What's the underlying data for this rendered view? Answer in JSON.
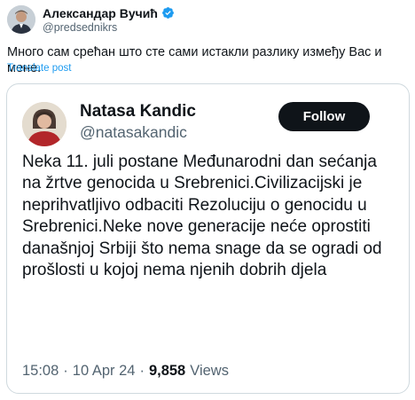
{
  "author": {
    "name": "Александар Вучић",
    "handle": "@predsednikrs",
    "verified": true
  },
  "post": {
    "text": "Много сам срећан што сте сами истакли разлику између Вас и мене.",
    "translate_label": "Translate post"
  },
  "quoted": {
    "name": "Natasa Kandic",
    "handle": "@natasakandic",
    "follow_label": "Follow",
    "text": "Neka 11. juli postane Međunarodni dan sećanja na žrtve genocida u Srebrenici.Civilizacijski je neprihvatljivo odbaciti Rezoluciju o genocidu u Srebrenici.Neke nove generacije neće oprostiti današnjoj Srbiji što nema snage da se ogradi od prošlosti u kojoj nema njenih dobrih djela",
    "time": "15:08",
    "date": "10 Apr 24",
    "views_count": "9,858",
    "views_label": "Views"
  },
  "colors": {
    "verified_badge": "#1d9bf0",
    "link": "#1d9bf0",
    "follow_bg": "#0f1419",
    "muted": "#536471"
  }
}
